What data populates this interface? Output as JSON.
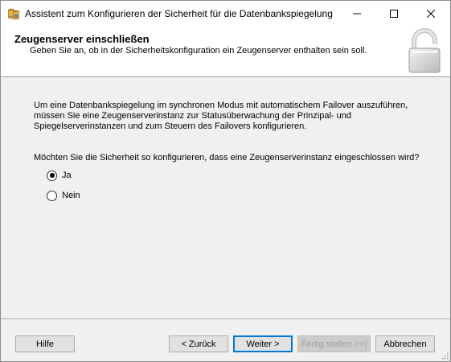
{
  "window": {
    "title": "Assistent zum Konfigurieren der Sicherheit für die Datenbankspiegelung"
  },
  "header": {
    "title": "Zeugenserver einschließen",
    "subtitle": "Geben Sie an, ob in der Sicherheitskonfiguration ein Zeugenserver enthalten sein soll."
  },
  "body": {
    "intro_lines": [
      "Um eine Datenbankspiegelung im synchronen Modus mit automatischem Failover auszuführen,",
      "müssen Sie eine Zeugenserverinstanz zur Statusüberwachung der Prinzipal- und",
      "Spiegelserverinstanzen und zum Steuern des Failovers konfigurieren."
    ],
    "question": "Möchten Sie die Sicherheit so konfigurieren, dass eine Zeugenserverinstanz eingeschlossen wird?",
    "options": [
      {
        "label": "Ja",
        "selected": true
      },
      {
        "label": "Nein",
        "selected": false
      }
    ]
  },
  "footer": {
    "help_label": "Hilfe",
    "back_label": "< Zurück",
    "next_label": "Weiter >",
    "finish_label": "Fertig stellen >>|",
    "cancel_label": "Abbrechen"
  },
  "colors": {
    "accent": "#0078d7",
    "dialog_bg": "#f0f0f0",
    "banner_bg": "#ffffff"
  },
  "icons": {
    "app": "database-mirroring-icon",
    "banner": "padlock-icon"
  }
}
